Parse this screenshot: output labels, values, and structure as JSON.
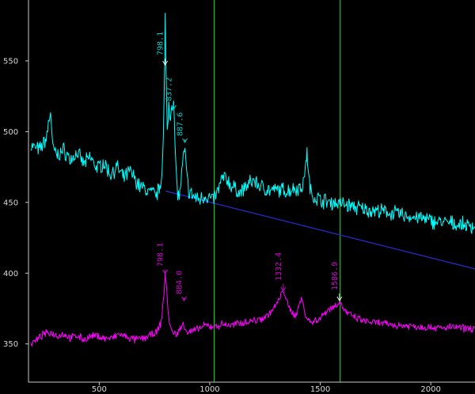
{
  "chart_data": {
    "type": "line",
    "title": "",
    "xlabel": "",
    "ylabel": "",
    "xlim": [
      180,
      2200
    ],
    "ylim": [
      323,
      593
    ],
    "x_ticks": [
      500,
      1000,
      1500,
      2000
    ],
    "y_ticks": [
      350,
      400,
      450,
      500,
      550
    ],
    "grid": false,
    "colors": {
      "background": "#000000",
      "axis": "#c8c8c8",
      "upper_series": "#00ffff",
      "lower_series": "#ff00ff",
      "baseline": "#2a2ad4",
      "cursor": "#12c812",
      "upper_labels": "#00cccc",
      "lower_labels": "#d000d0",
      "label_hilite": "#e8e8e8"
    },
    "cursors": [
      1020,
      1590
    ],
    "series": [
      {
        "color": "#00ffff",
        "points": [
          [
            190,
            490
          ],
          [
            230,
            487
          ],
          [
            260,
            495
          ],
          [
            270,
            505
          ],
          [
            280,
            515
          ],
          [
            290,
            488
          ],
          [
            310,
            483
          ],
          [
            340,
            487
          ],
          [
            370,
            480
          ],
          [
            400,
            485
          ],
          [
            430,
            477
          ],
          [
            460,
            482
          ],
          [
            490,
            474
          ],
          [
            520,
            478
          ],
          [
            550,
            470
          ],
          [
            580,
            475
          ],
          [
            610,
            467
          ],
          [
            640,
            472
          ],
          [
            680,
            462
          ],
          [
            720,
            458
          ],
          [
            760,
            455
          ],
          [
            780,
            465
          ],
          [
            790,
            495
          ],
          [
            796,
            545
          ],
          [
            798,
            581
          ],
          [
            802,
            540
          ],
          [
            808,
            500
          ],
          [
            815,
            520
          ],
          [
            820,
            510
          ],
          [
            828,
            520
          ],
          [
            837,
            520
          ],
          [
            843,
            490
          ],
          [
            850,
            465
          ],
          [
            855,
            457
          ],
          [
            862,
            453
          ],
          [
            870,
            465
          ],
          [
            880,
            480
          ],
          [
            888,
            487
          ],
          [
            895,
            470
          ],
          [
            905,
            458
          ],
          [
            920,
            455
          ],
          [
            950,
            452
          ],
          [
            980,
            455
          ],
          [
            1010,
            452
          ],
          [
            1030,
            455
          ],
          [
            1040,
            460
          ],
          [
            1060,
            468
          ],
          [
            1080,
            466
          ],
          [
            1100,
            461
          ],
          [
            1140,
            457
          ],
          [
            1170,
            462
          ],
          [
            1200,
            466
          ],
          [
            1220,
            462
          ],
          [
            1250,
            460
          ],
          [
            1280,
            458
          ],
          [
            1320,
            459
          ],
          [
            1350,
            458
          ],
          [
            1380,
            460
          ],
          [
            1400,
            460
          ],
          [
            1420,
            462
          ],
          [
            1435,
            475
          ],
          [
            1440,
            490
          ],
          [
            1445,
            470
          ],
          [
            1460,
            455
          ],
          [
            1500,
            452
          ],
          [
            1550,
            450
          ],
          [
            1600,
            449
          ],
          [
            1650,
            447
          ],
          [
            1700,
            445
          ],
          [
            1750,
            444
          ],
          [
            1800,
            443
          ],
          [
            1850,
            442
          ],
          [
            1900,
            440
          ],
          [
            1950,
            439
          ],
          [
            2000,
            437
          ],
          [
            2050,
            436
          ],
          [
            2100,
            435
          ],
          [
            2150,
            434
          ],
          [
            2200,
            433
          ]
        ]
      },
      {
        "color": "#ff00ff",
        "points": [
          [
            190,
            350
          ],
          [
            220,
            353
          ],
          [
            250,
            357
          ],
          [
            280,
            358
          ],
          [
            310,
            356
          ],
          [
            340,
            357
          ],
          [
            370,
            354
          ],
          [
            400,
            356
          ],
          [
            430,
            353
          ],
          [
            460,
            355
          ],
          [
            490,
            356
          ],
          [
            520,
            354
          ],
          [
            560,
            354
          ],
          [
            590,
            357
          ],
          [
            620,
            355
          ],
          [
            660,
            353
          ],
          [
            700,
            354
          ],
          [
            730,
            356
          ],
          [
            760,
            358
          ],
          [
            780,
            365
          ],
          [
            790,
            380
          ],
          [
            798,
            398
          ],
          [
            805,
            390
          ],
          [
            812,
            372
          ],
          [
            820,
            363
          ],
          [
            830,
            358
          ],
          [
            850,
            357
          ],
          [
            870,
            361
          ],
          [
            880,
            365
          ],
          [
            890,
            361
          ],
          [
            900,
            358
          ],
          [
            940,
            360
          ],
          [
            980,
            363
          ],
          [
            1020,
            362
          ],
          [
            1060,
            364
          ],
          [
            1100,
            363
          ],
          [
            1140,
            365
          ],
          [
            1180,
            366
          ],
          [
            1220,
            367
          ],
          [
            1260,
            370
          ],
          [
            1290,
            375
          ],
          [
            1310,
            380
          ],
          [
            1325,
            385
          ],
          [
            1332,
            389
          ],
          [
            1340,
            385
          ],
          [
            1355,
            376
          ],
          [
            1370,
            373
          ],
          [
            1390,
            370
          ],
          [
            1405,
            378
          ],
          [
            1415,
            382
          ],
          [
            1425,
            376
          ],
          [
            1440,
            368
          ],
          [
            1460,
            365
          ],
          [
            1480,
            367
          ],
          [
            1500,
            368
          ],
          [
            1520,
            372
          ],
          [
            1540,
            375
          ],
          [
            1560,
            376
          ],
          [
            1575,
            378
          ],
          [
            1587,
            380
          ],
          [
            1600,
            376
          ],
          [
            1620,
            372
          ],
          [
            1650,
            369
          ],
          [
            1700,
            366
          ],
          [
            1750,
            365
          ],
          [
            1800,
            364
          ],
          [
            1850,
            363
          ],
          [
            1900,
            363
          ],
          [
            1950,
            362
          ],
          [
            2000,
            362
          ],
          [
            2050,
            361
          ],
          [
            2100,
            362
          ],
          [
            2150,
            361
          ],
          [
            2200,
            361
          ]
        ]
      }
    ],
    "baseline": [
      [
        800,
        458
      ],
      [
        2200,
        403
      ]
    ],
    "peak_labels_upper": [
      {
        "x": 798.1,
        "text": "798.1",
        "highlight": true
      },
      {
        "x": 837.2,
        "text": "837.2",
        "highlight": false
      },
      {
        "x": 887.6,
        "text": "887.6",
        "highlight": false
      }
    ],
    "peak_labels_lower": [
      {
        "x": 798.1,
        "text": "798.1",
        "highlight": false
      },
      {
        "x": 884.0,
        "text": "884.0",
        "highlight": false
      },
      {
        "x": 1332.4,
        "text": "1332.4",
        "highlight": false
      },
      {
        "x": 1586.9,
        "text": "1586.9",
        "highlight": true
      }
    ]
  }
}
